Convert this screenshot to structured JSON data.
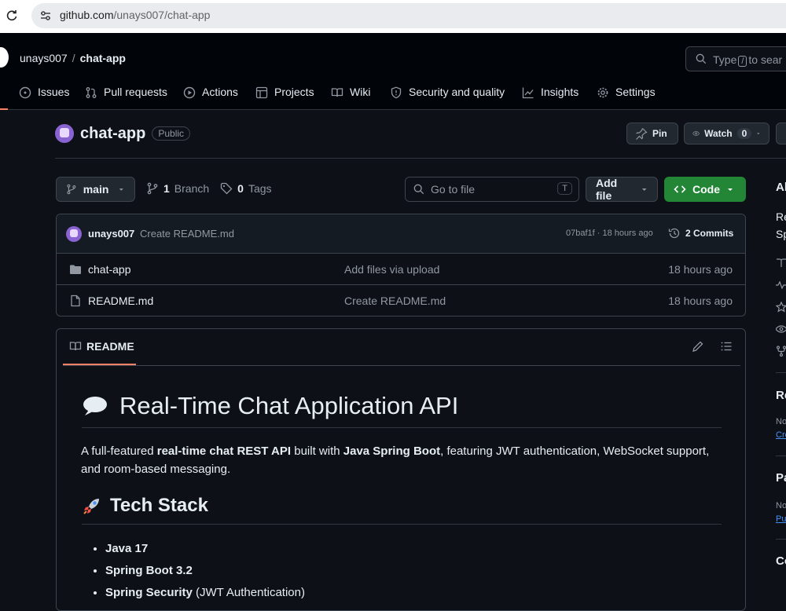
{
  "browser": {
    "url_host": "github.com",
    "url_path": "/unays007/chat-app"
  },
  "header": {
    "owner": "unays007",
    "separator": "/",
    "repo": "chat-app",
    "search_pre": "Type",
    "search_key": "/",
    "search_post": "to sear"
  },
  "nav": {
    "items": [
      {
        "label": "Issues"
      },
      {
        "label": "Pull requests"
      },
      {
        "label": "Actions"
      },
      {
        "label": "Projects"
      },
      {
        "label": "Wiki"
      },
      {
        "label": "Security and quality"
      },
      {
        "label": "Insights"
      },
      {
        "label": "Settings"
      }
    ]
  },
  "repo": {
    "name": "chat-app",
    "visibility": "Public",
    "pin_label": "Pin",
    "watch_label": "Watch",
    "watch_count": "0"
  },
  "branch": {
    "current": "main",
    "branch_count": "1",
    "branch_label": "Branch",
    "tag_count": "0",
    "tag_label": "Tags",
    "goto_placeholder": "Go to file",
    "goto_key": "T",
    "add_file_label": "Add file",
    "code_label": "Code"
  },
  "commit": {
    "author": "unays007",
    "message": "Create README.md",
    "hash_time": "07baf1f · 18 hours ago",
    "commit_count": "2 Commits"
  },
  "files": [
    {
      "name": "chat-app",
      "type": "folder",
      "message": "Add files via upload",
      "time": "18 hours ago"
    },
    {
      "name": "README.md",
      "type": "file",
      "message": "Create README.md",
      "time": "18 hours ago"
    }
  ],
  "readme": {
    "tab_label": "README",
    "h1": "Real-Time Chat Application API",
    "p_1": "A full-featured ",
    "p_bold_1": "real-time chat REST API",
    "p_2": " built with ",
    "p_bold_2": "Java Spring Boot",
    "p_3": ", featuring JWT authentication, WebSocket support, and room-based messaging.",
    "h2": "Tech Stack",
    "tech_list": [
      {
        "bold": "Java 17",
        "rest": ""
      },
      {
        "bold": "Spring Boot 3.2",
        "rest": ""
      },
      {
        "bold": "Spring Security",
        "rest": " (JWT Authentication)"
      }
    ]
  },
  "sidebar": {
    "about_h": "Al",
    "about_line1": "Re",
    "about_line2": "Sp",
    "releases_h": "Re",
    "releases_muted": "No",
    "releases_link": "Cre",
    "packages_h": "Pa",
    "packages_muted": "No",
    "packages_link": "Pu",
    "contrib_h": "Co"
  },
  "colors": {
    "bg": "#0d1117",
    "header_bg": "#010409",
    "accent_underline": "#f78166",
    "code_button": "#238636",
    "link": "#4493f8"
  }
}
